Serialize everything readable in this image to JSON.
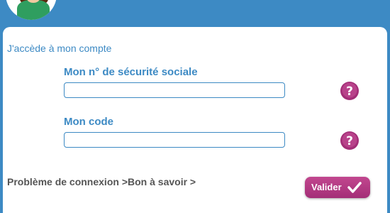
{
  "login_form": {
    "heading": "J'accède à mon compte",
    "ssn_label": "Mon n° de sécurité sociale",
    "ssn_value": "",
    "code_label": "Mon code",
    "code_value": "",
    "problem_link": "Problème de connexion >",
    "info_link": "Bon à savoir >",
    "validate_label": "Valider"
  },
  "colors": {
    "header_blue": "#3d8ac4",
    "accent_magenta": "#a32e77",
    "link_gray": "#555555"
  },
  "icons": {
    "help": "help-icon",
    "validate": "checkmark-icon",
    "avatar": "user-avatar"
  }
}
